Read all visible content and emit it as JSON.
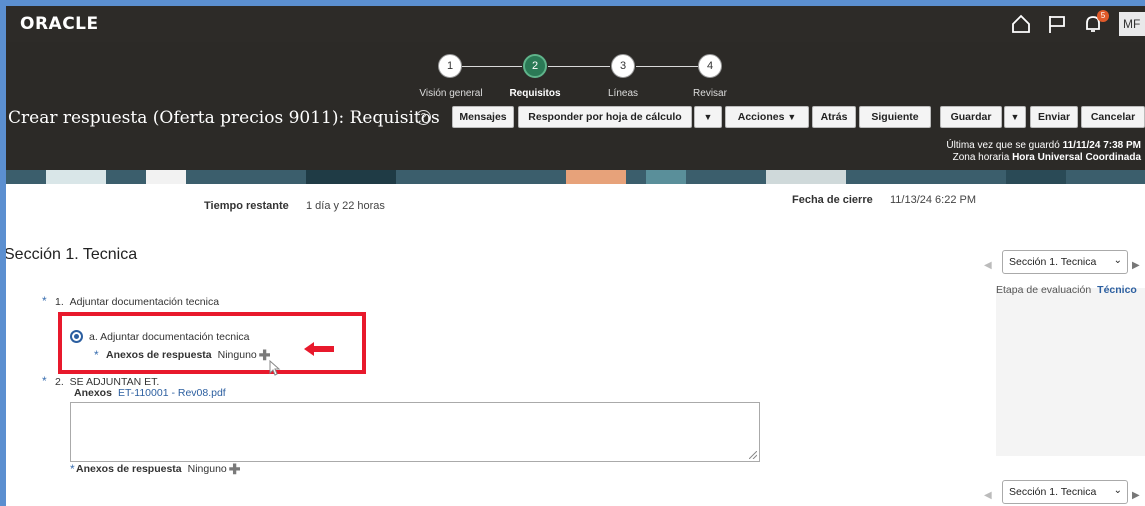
{
  "header": {
    "logo": "ORACLE",
    "avatar_initials": "MF",
    "notification_count": "5"
  },
  "train": {
    "steps": [
      {
        "number": "1",
        "label": "Visión general",
        "active": false
      },
      {
        "number": "2",
        "label": "Requisitos",
        "active": true
      },
      {
        "number": "3",
        "label": "Líneas",
        "active": false
      },
      {
        "number": "4",
        "label": "Revisar",
        "active": false
      }
    ]
  },
  "page": {
    "title": "Crear respuesta (Oferta precios 9011): Requisitos",
    "help_icon": "?"
  },
  "toolbar": {
    "mensajes": "Mensajes",
    "responder": "Responder por hoja de cálculo",
    "acciones": "Acciones",
    "atras": "Atrás",
    "siguiente": "Siguiente",
    "guardar": "Guardar",
    "enviar": "Enviar",
    "cancelar": "Cancelar",
    "caret": "▼"
  },
  "status": {
    "last_saved_label": "Última vez que se guardó",
    "last_saved_value": "11/11/24 7:38 PM",
    "timezone_label": "Zona horaria",
    "timezone_value": "Hora Universal Coordinada"
  },
  "summary": {
    "tiempo_label": "Tiempo restante",
    "tiempo_value": "1 día y 22 horas",
    "cierre_label": "Fecha de cierre",
    "cierre_value": "11/13/24 6:22 PM"
  },
  "section": {
    "title": "Sección 1. Tecnica",
    "selector_value": "Sección 1. Tecnica",
    "etapa_label": "Etapa de evaluación",
    "etapa_value": "Técnico"
  },
  "questions": [
    {
      "number": "1.",
      "text": "Adjuntar documentación tecnica",
      "option": "a. Adjuntar documentación tecnica",
      "anexos_label": "Anexos de respuesta",
      "anexos_value": "Ninguno"
    },
    {
      "number": "2.",
      "text": "SE ADJUNTAN ET.",
      "anexos_label": "Anexos",
      "anexos_link": "ET-110001 - Rev08.pdf",
      "resp_anexos_label": "Anexos de respuesta",
      "resp_anexos_value": "Ninguno"
    }
  ],
  "colors": {
    "header_bg": "#2d2b28",
    "active_step": "#2b7a56",
    "highlight": "#e8192c",
    "link": "#2c5fa0"
  }
}
